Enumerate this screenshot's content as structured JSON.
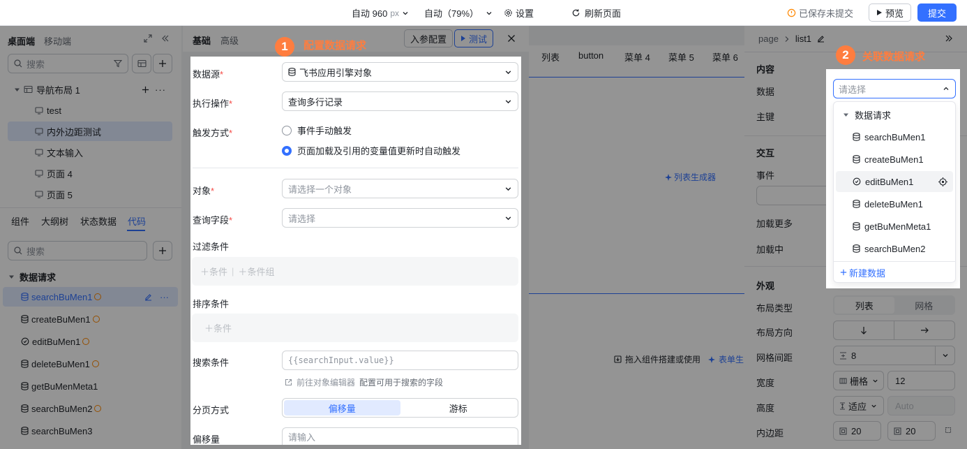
{
  "topbar": {
    "width_label": "自动 960",
    "width_unit": "px",
    "height_label": "自动（79%）",
    "settings": "设置",
    "refresh": "刷新页面",
    "saved_status": "已保存未提交",
    "preview": "预览",
    "submit": "提交"
  },
  "left": {
    "tabs": [
      "桌面端",
      "移动端"
    ],
    "search_placeholder": "搜索",
    "nav_layout": "导航布局 1",
    "pages": [
      "test",
      "内外边距测试",
      "文本输入",
      "页面 4",
      "页面 5"
    ],
    "bottom_tabs": [
      "组件",
      "大纲树",
      "状态数据",
      "代码"
    ],
    "search2_placeholder": "搜索",
    "group": "数据请求",
    "requests": [
      "searchBuMen1",
      "createBuMen1",
      "editBuMen1",
      "deleteBuMen1",
      "getBuMenMeta1",
      "searchBuMen2",
      "searchBuMen3"
    ]
  },
  "config": {
    "tabs": [
      "基础",
      "高级"
    ],
    "params_button": "入参配置",
    "test_button": "测试",
    "datasource_label": "数据源",
    "datasource_value": "飞书应用引擎对象",
    "operation_label": "执行操作",
    "operation_value": "查询多行记录",
    "trigger_label": "触发方式",
    "trigger_options": [
      "事件手动触发",
      "页面加载及引用的变量值更新时自动触发"
    ],
    "object_label": "对象",
    "object_placeholder": "请选择一个对象",
    "fields_label": "查询字段",
    "fields_placeholder": "请选择",
    "filter_label": "过滤条件",
    "filter_add": "条件",
    "filter_add_group": "条件组",
    "sort_label": "排序条件",
    "sort_add": "条件",
    "search_label": "搜索条件",
    "search_value": "{{searchInput.value}}",
    "search_hint_link": "前往对象编辑器",
    "search_hint_text": "配置可用于搜索的字段",
    "paging_label": "分页方式",
    "paging_options": [
      "偏移量",
      "游标"
    ],
    "offset_label": "偏移量",
    "offset_placeholder": "请输入"
  },
  "canvas": {
    "nav_items": [
      "列表",
      "button",
      "菜单 4",
      "菜单 5",
      "菜单 6"
    ],
    "list_generator": "列表生成器",
    "drop_hint": "拖入组件搭建或使用",
    "form_gen": "表单生"
  },
  "right": {
    "breadcrumb": [
      "page",
      "list1"
    ],
    "content_section": "内容",
    "data_label": "数据",
    "key_label": "主键",
    "interact_section": "交互",
    "event_label": "事件",
    "load_more_label": "加载更多",
    "loading_label": "加载中",
    "appearance_section": "外观",
    "layout_type_label": "布局类型",
    "layout_types": [
      "列表",
      "网格"
    ],
    "layout_dir_label": "布局方向",
    "grid_gap_label": "网格间距",
    "grid_gap_value": "8",
    "width_label": "宽度",
    "width_mode": "栅格",
    "width_value": "12",
    "height_label": "高度",
    "height_mode": "适应",
    "height_placeholder": "Auto",
    "padding_label": "内边距",
    "padding_values": [
      "20",
      "20"
    ]
  },
  "dropdown": {
    "placeholder": "请选择",
    "group": "数据请求",
    "items": [
      "searchBuMen1",
      "createBuMen1",
      "editBuMen1",
      "deleteBuMen1",
      "getBuMenMeta1",
      "searchBuMen2"
    ],
    "new_data": "新建数据"
  },
  "callouts": {
    "step1_num": "1",
    "step1_text": "配置数据请求",
    "step2_num": "2",
    "step2_text": "关联数据请求"
  },
  "colors": {
    "accent": "#3370ff",
    "warning": "#ff8800",
    "callout": "#ff7d3f"
  }
}
